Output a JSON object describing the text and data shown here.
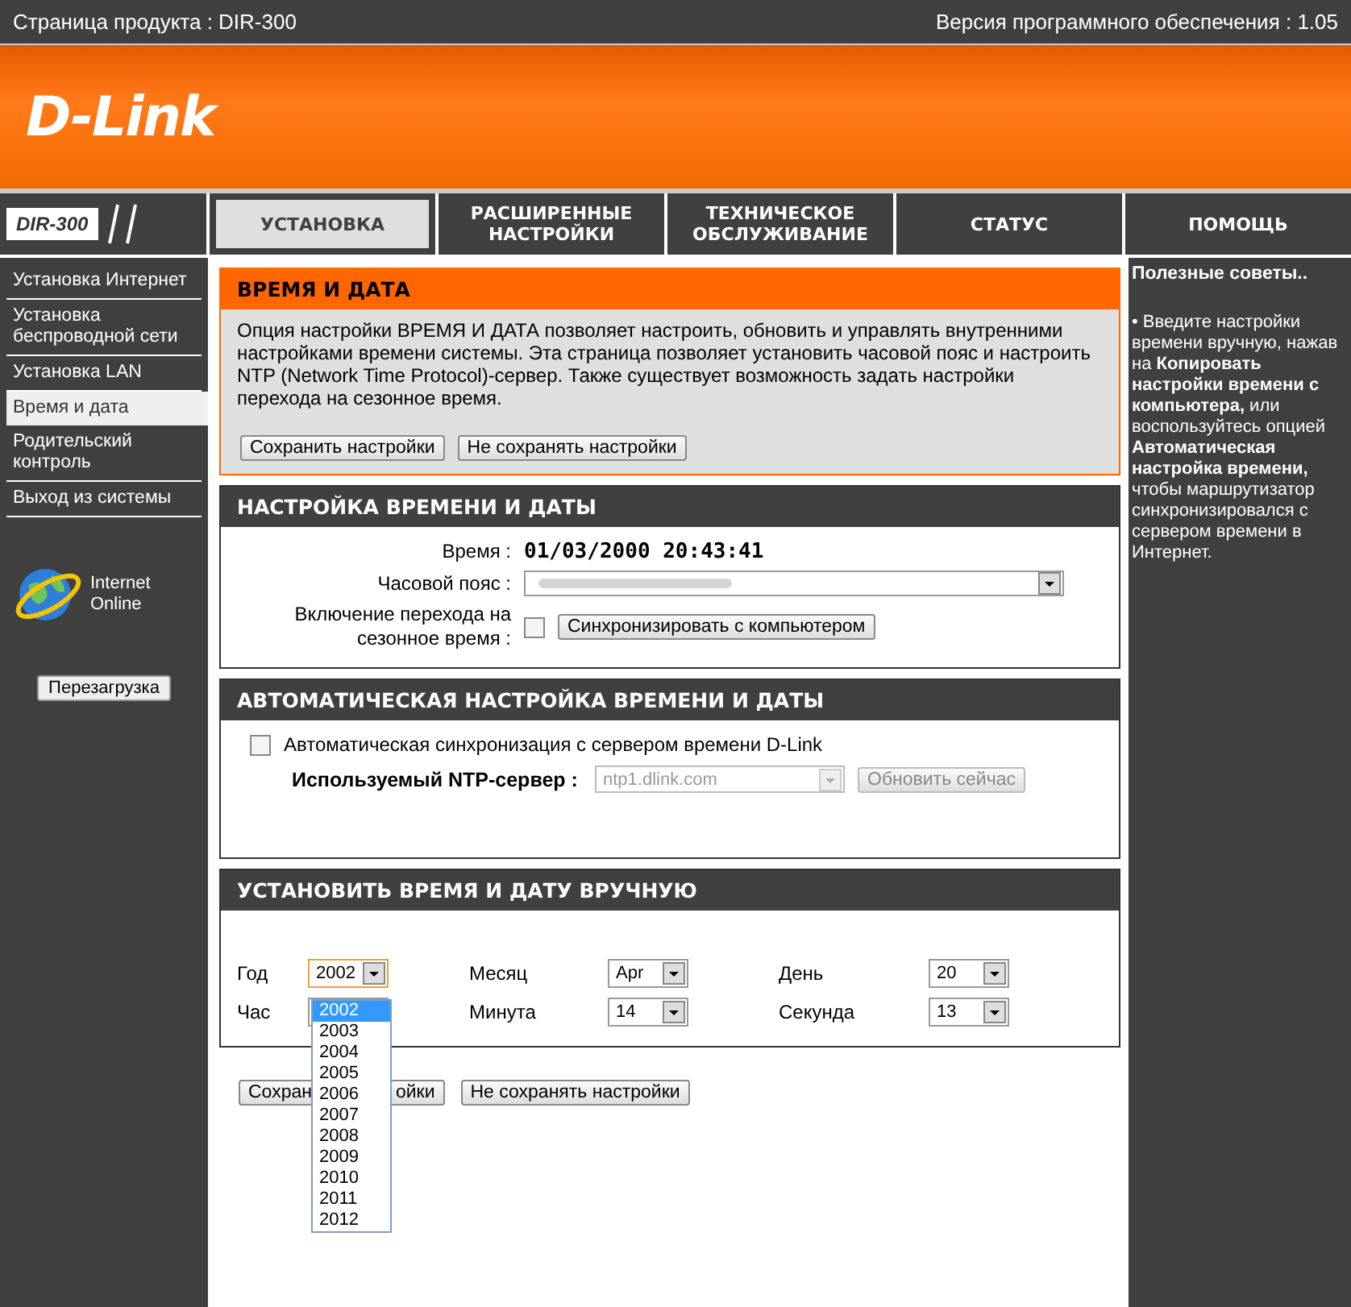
{
  "top_bar": {
    "product": "Страница продукта :  DIR-300",
    "firmware": "Версия программного обеспечения : 1.05"
  },
  "logo": "D-Link",
  "model_badge": "DIR-300",
  "nav_tabs": [
    {
      "label": "УСТАНОВКА",
      "selected": true
    },
    {
      "label": "РАСШИРЕННЫЕ НАСТРОЙКИ",
      "selected": false
    },
    {
      "label": "ТЕХНИЧЕСКОЕ ОБСЛУЖИВАНИЕ",
      "selected": false
    },
    {
      "label": "СТАТУС",
      "selected": false
    },
    {
      "label": "ПОМОЩЬ",
      "selected": false
    }
  ],
  "sidebar": {
    "items": [
      {
        "label": "Установка Интернет",
        "selected": false
      },
      {
        "label": "Установка беспроводной сети",
        "selected": false
      },
      {
        "label": "Установка LAN",
        "selected": false
      },
      {
        "label": "Время и дата",
        "selected": true
      },
      {
        "label": "Родительский контроль",
        "selected": false
      },
      {
        "label": "Выход из системы",
        "selected": false
      }
    ],
    "status": "Internet Online",
    "reboot_button": "Перезагрузка"
  },
  "intro": {
    "title": "ВРЕМЯ И ДАТА",
    "text": "Опция настройки ВРЕМЯ И ДАТА позволяет настроить, обновить и управлять внутренними настройками времени системы. Эта страница позволяет установить часовой пояс и настроить NTP (Network Time Protocol)-сервер. Также существует возможность задать настройки перехода на сезонное время.",
    "buttons": [
      "Сохранить настройки",
      "Не сохранять настройки"
    ]
  },
  "time_settings": {
    "title": "НАСТРОЙКА ВРЕМЕНИ И ДАТЫ",
    "time_label": "Время :",
    "time_value": "01/03/2000 20:43:41",
    "timezone_label": "Часовой пояс :",
    "dst_label": "Включение перехода на сезонное время :",
    "dst_checked": false,
    "sync_button": "Синхронизировать с компьютером"
  },
  "auto_ntp": {
    "title": "АВТОМАТИЧЕСКАЯ НАСТРОЙКА ВРЕМЕНИ И ДАТЫ",
    "auto_sync_label": "Автоматическая синхронизация с сервером времени D-Link",
    "auto_sync_checked": false,
    "ntp_label": "Используемый NTP-сервер :",
    "ntp_value": "ntp1.dlink.com",
    "ntp_disabled": true,
    "update_button": "Обновить сейчас"
  },
  "manual": {
    "title": "УСТАНОВИТЬ ВРЕМЯ И ДАТУ ВРУЧНУЮ",
    "fields": [
      {
        "label": "Год",
        "value": "2002",
        "open": true
      },
      {
        "label": "Месяц",
        "value": "Apr",
        "open": false
      },
      {
        "label": "День",
        "value": "20",
        "open": false
      },
      {
        "label": "Час",
        "open": false
      },
      {
        "label": "Минута",
        "value": "14",
        "open": false
      },
      {
        "label": "Секунда",
        "value": "13",
        "open": false
      }
    ],
    "year_options": [
      {
        "label": "2002",
        "selected": true
      },
      {
        "label": "2003",
        "selected": false
      },
      {
        "label": "2004",
        "selected": false
      },
      {
        "label": "2005",
        "selected": false
      },
      {
        "label": "2006",
        "selected": false
      },
      {
        "label": "2007",
        "selected": false
      },
      {
        "label": "2008",
        "selected": false
      },
      {
        "label": "2009",
        "selected": false
      },
      {
        "label": "2010",
        "selected": false
      },
      {
        "label": "2011",
        "selected": false
      },
      {
        "label": "2012",
        "selected": false
      }
    ]
  },
  "bottom_buttons": [
    {
      "visible_parts": [
        "Сохран",
        "ойки"
      ]
    },
    {
      "visible_parts": [
        "Не сохранять настройки"
      ]
    }
  ],
  "help": {
    "title": "Полезные советы..",
    "text": "• Введите настройки времени вручную, нажав на **Копировать настройки времени с компьютера,** или воспользуйтесь опцией **Автоматическая настройка времени,** чтобы маршрутизатор синхронизировался с сервером времени в Интернет."
  }
}
